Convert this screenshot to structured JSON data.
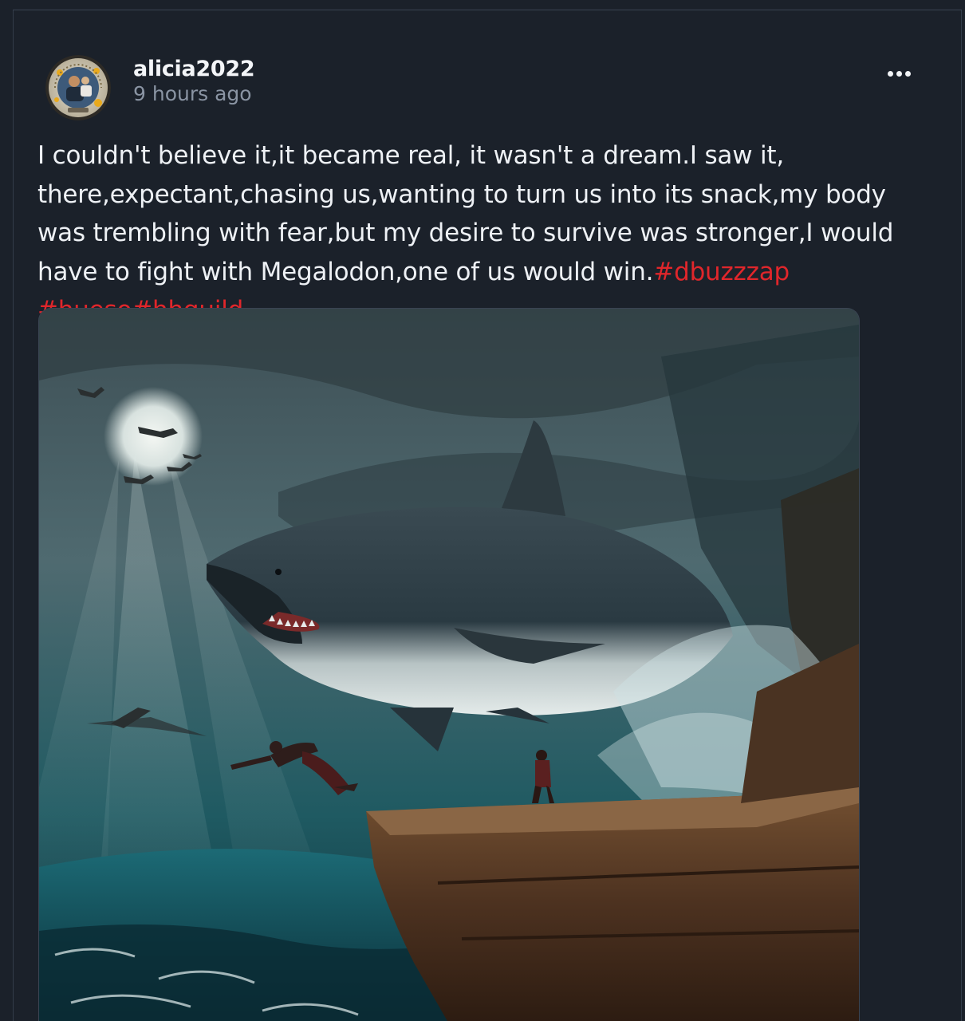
{
  "post": {
    "username": "alicia2022",
    "timestamp": "9 hours ago",
    "body_text": "I couldn't believe it,it became real, it wasn't a dream.I saw it, there,expectant,chasing us,wanting to turn us into its snack,my body was trembling with fear,but my desire to survive was stronger,I would have to fight with Megalodon,one of us would win.",
    "hashtags": [
      "#dbuzzzap",
      "#hueso",
      "#hhguild"
    ],
    "hashtag_separators": [
      " ",
      "",
      ""
    ],
    "more_icon": "more-horizontal-icon",
    "image_subject": "megalodon-shark-scene"
  },
  "colors": {
    "background": "#1b212a",
    "hashtag": "#e0262b",
    "username": "#f3f5f8",
    "timestamp": "#8a94a3"
  }
}
